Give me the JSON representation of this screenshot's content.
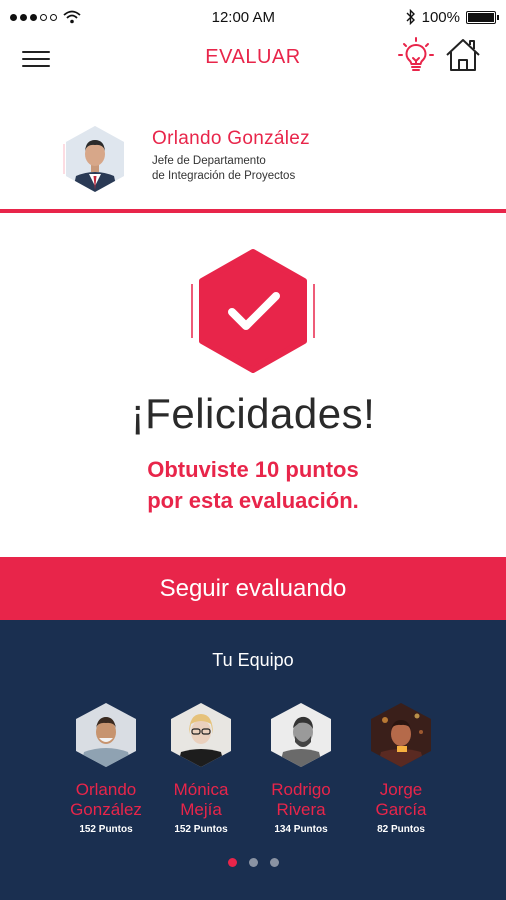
{
  "status_bar": {
    "time": "12:00 AM",
    "battery": "100%"
  },
  "header": {
    "title": "EVALUAR",
    "menu_icon": "menu-icon",
    "bulb_icon": "lightbulb-icon",
    "home_icon": "home-icon"
  },
  "profile": {
    "name": "Orlando González",
    "role_line1": "Jefe de Departamento",
    "role_line2": "de Integración de Proyectos"
  },
  "result": {
    "title": "¡Felicidades!",
    "message_line1": "Obtuviste 10 puntos",
    "message_line2": "por esta evaluación.",
    "icon": "check-icon"
  },
  "continue_button": {
    "label": "Seguir evaluando"
  },
  "team": {
    "title": "Tu Equipo",
    "members": [
      {
        "first": "Orlando",
        "last": "González",
        "points": "152 Puntos"
      },
      {
        "first": "Mónica",
        "last": "Mejía",
        "points": "152 Puntos"
      },
      {
        "first": "Rodrigo",
        "last": "Rivera",
        "points": "134 Puntos"
      },
      {
        "first": "Jorge",
        "last": "García",
        "points": "82 Puntos"
      }
    ],
    "pages": 3,
    "active_page": 1
  },
  "colors": {
    "accent": "#e8254a",
    "navy": "#1a2f50"
  }
}
